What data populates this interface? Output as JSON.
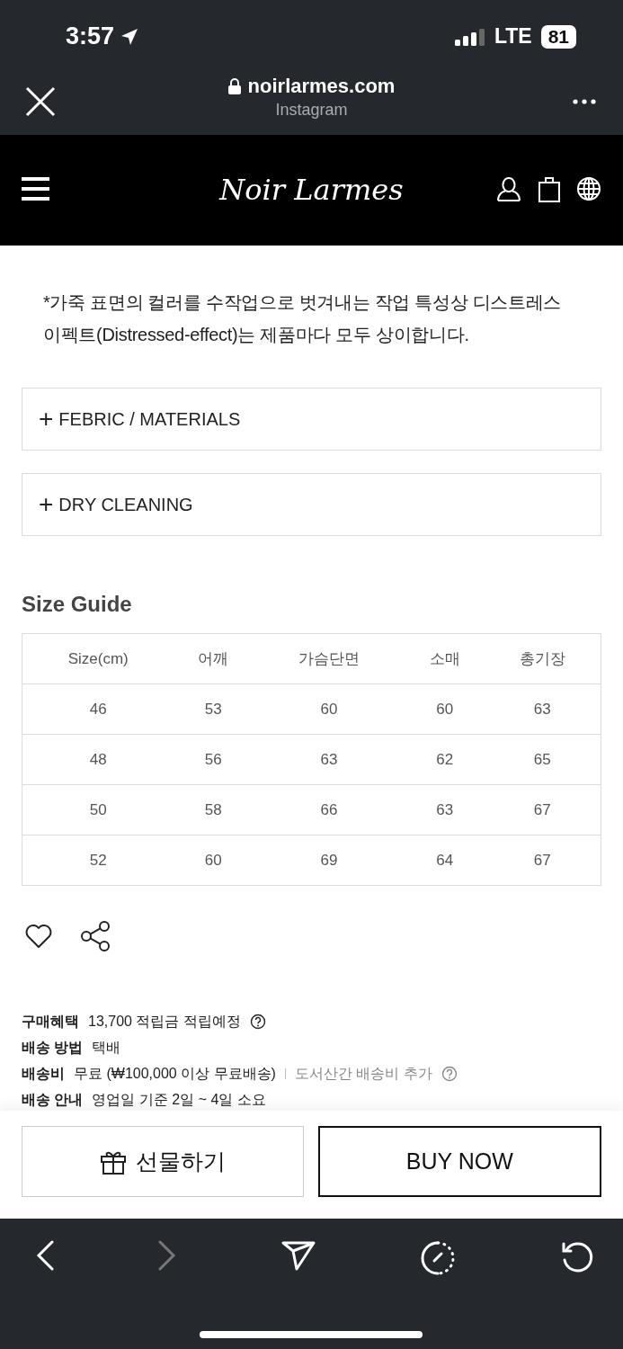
{
  "status_bar": {
    "time": "3:57",
    "network": "LTE",
    "battery": "81"
  },
  "browser_bar": {
    "domain": "noirlarmes.com",
    "source": "Instagram"
  },
  "site_header": {
    "logo": "Noir Larmes"
  },
  "description": {
    "note": "*가죽 표면의 컬러를 수작업으로 벗겨내는 작업 특성상 디스트레스 이펙트(Distressed-effect)는 제품마다 모두 상이합니다."
  },
  "accordions": [
    {
      "icon": "+",
      "label": "FEBRIC / MATERIALS",
      "expanded": false
    },
    {
      "icon": "+",
      "label": "DRY CLEANING",
      "expanded": false
    }
  ],
  "size_guide": {
    "title": "Size Guide",
    "columns": [
      "Size(cm)",
      "어깨",
      "가슴단면",
      "소매",
      "총기장"
    ],
    "rows": [
      [
        "46",
        "53",
        "60",
        "60",
        "63"
      ],
      [
        "48",
        "56",
        "63",
        "62",
        "65"
      ],
      [
        "50",
        "58",
        "66",
        "63",
        "67"
      ],
      [
        "52",
        "60",
        "69",
        "64",
        "67"
      ]
    ]
  },
  "info": [
    {
      "label": "구매혜택",
      "value": "13,700 적립금 적립예정",
      "help": true
    },
    {
      "label": "배송 방법",
      "value": "택배",
      "help": false
    },
    {
      "label": "배송비",
      "value": "무료 (₩100,000 이상 무료배송)",
      "extra": "도서산간 배송비 추가",
      "help": true
    },
    {
      "label": "배송 안내",
      "value": "영업일 기준 2일 ~ 4일 소요",
      "help": false
    }
  ],
  "actions": {
    "gift": "선물하기",
    "buy": "BUY NOW"
  },
  "browser_nav": {
    "forward_disabled": true
  }
}
